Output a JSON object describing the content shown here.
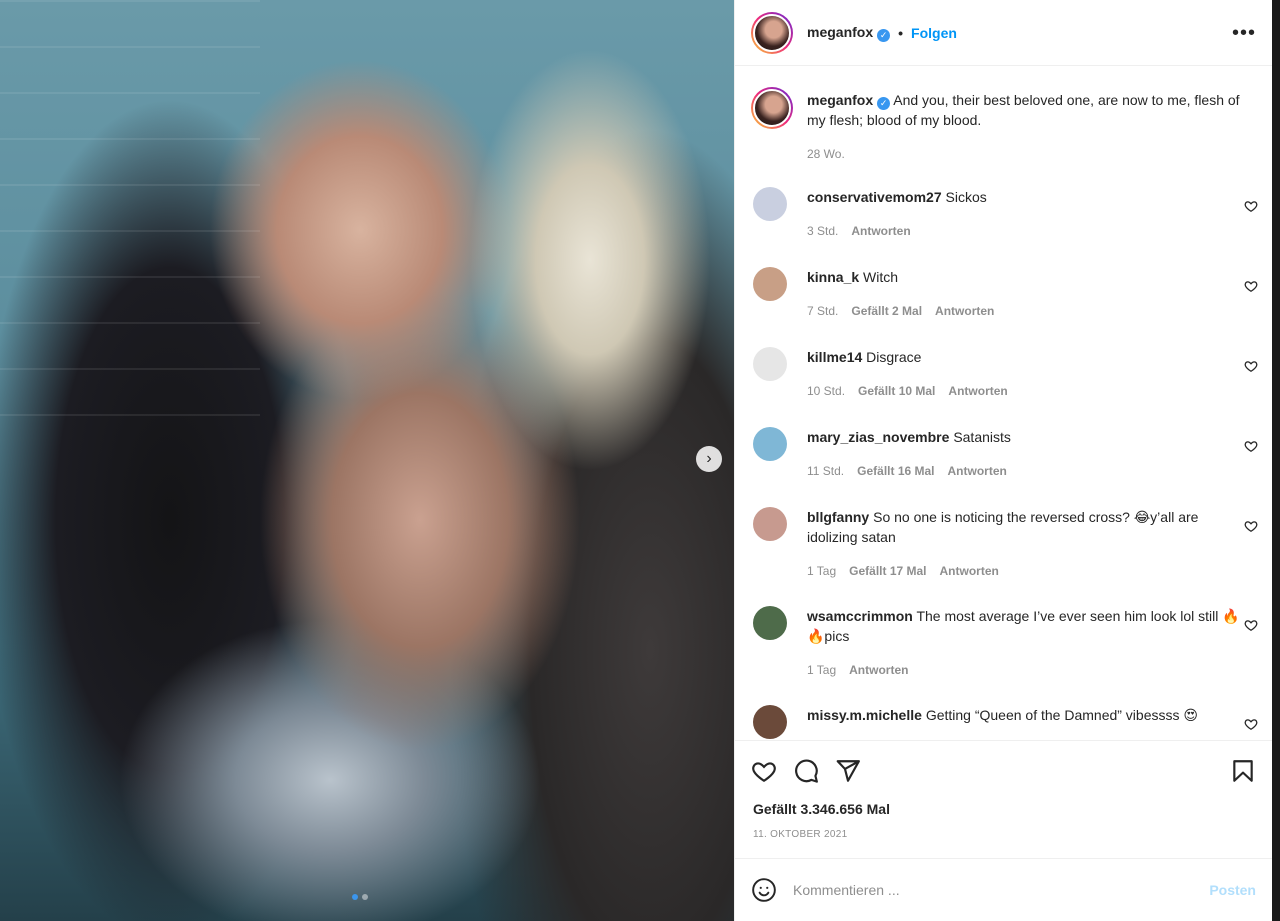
{
  "post": {
    "username": "meganfox",
    "follow_label": "Folgen",
    "separator": "•",
    "more_label": "•••",
    "caption": "And you, their best beloved one, are now to me, flesh of my flesh; blood of my blood.",
    "caption_age": "28 Wo.",
    "likes": "Gefällt 3.346.656 Mal",
    "date": "11. OKTOBER 2021",
    "next_label": "›"
  },
  "comments": [
    {
      "user": "conservativemom27",
      "text": "Sickos",
      "age": "3 Std.",
      "likes": "",
      "reply": "Antworten",
      "avatar_color": "#c9cfe0"
    },
    {
      "user": "kinna_k",
      "text": "Witch",
      "age": "7 Std.",
      "likes": "Gefällt 2 Mal",
      "reply": "Antworten",
      "avatar_color": "#c89f86"
    },
    {
      "user": "killme14",
      "text": "Disgrace",
      "age": "10 Std.",
      "likes": "Gefällt 10 Mal",
      "reply": "Antworten",
      "avatar_color": "#e6e6e6"
    },
    {
      "user": "mary_zias_novembre",
      "text": "Satanists",
      "age": "11 Std.",
      "likes": "Gefällt 16 Mal",
      "reply": "Antworten",
      "avatar_color": "#7fb7d6"
    },
    {
      "user": "bllgfanny",
      "text": "So no one is noticing the reversed cross? 😂y’all are idolizing satan",
      "age": "1 Tag",
      "likes": "Gefällt 17 Mal",
      "reply": "Antworten",
      "avatar_color": "#c79a8f"
    },
    {
      "user": "wsamccrimmon",
      "text": "The most average I’ve ever seen him look lol still 🔥🔥pics",
      "age": "1 Tag",
      "likes": "",
      "reply": "Antworten",
      "avatar_color": "#4e6b4a"
    },
    {
      "user": "missy.m.michelle",
      "text": "Getting “Queen of the Damned” vibessss 😍",
      "age": "",
      "likes": "",
      "reply": "",
      "avatar_color": "#6b4a3a"
    }
  ],
  "add_comment": {
    "placeholder": "Kommentieren ...",
    "post_label": "Posten"
  },
  "icons": {
    "like": "heart-icon",
    "comment": "comment-icon",
    "share": "paper-plane-icon",
    "save": "bookmark-icon",
    "emoji": "smiley-icon",
    "more": "more-horizontal-icon",
    "verified": "verified-badge-icon"
  },
  "colors": {
    "accent_blue": "#0095f6",
    "muted": "#8e8e8e",
    "post_disabled": "#b2dffc"
  }
}
